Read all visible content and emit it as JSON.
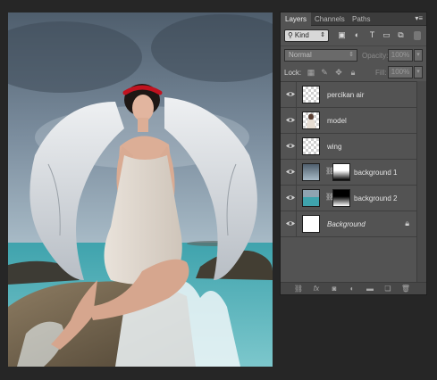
{
  "panel": {
    "tabs": [
      {
        "label": "Layers",
        "active": true
      },
      {
        "label": "Channels",
        "active": false
      },
      {
        "label": "Paths",
        "active": false
      }
    ],
    "menu_icon": "panel-menu-icon"
  },
  "filter": {
    "kind_label": "Kind",
    "icons": [
      "pixel-filter-icon",
      "adjustment-filter-icon",
      "type-filter-icon",
      "shape-filter-icon",
      "smart-object-filter-icon"
    ]
  },
  "blend": {
    "mode": "Normal",
    "opacity_label": "Opacity:",
    "opacity_value": "100%"
  },
  "lock": {
    "label": "Lock:",
    "fill_label": "Fill:",
    "fill_value": "100%",
    "icons": [
      "lock-transparent-icon",
      "lock-image-icon",
      "lock-position-icon",
      "lock-all-icon"
    ]
  },
  "layers": [
    {
      "name": "percikan air",
      "thumb": "checker",
      "italic": false,
      "masked": false,
      "locked": false,
      "visible": true
    },
    {
      "name": "model",
      "thumb": "model",
      "italic": false,
      "masked": false,
      "locked": false,
      "visible": true
    },
    {
      "name": "wing",
      "thumb": "checker",
      "italic": false,
      "masked": false,
      "locked": false,
      "visible": true
    },
    {
      "name": "background 1",
      "thumb": "sky",
      "italic": false,
      "masked": true,
      "locked": false,
      "visible": true
    },
    {
      "name": "background 2",
      "thumb": "sea",
      "italic": false,
      "masked": true,
      "locked": false,
      "visible": true
    },
    {
      "name": "Background",
      "thumb": "white",
      "italic": true,
      "masked": false,
      "locked": true,
      "visible": true
    }
  ],
  "footer_icons": [
    "link-layers-icon",
    "fx-icon",
    "add-mask-icon",
    "adjustment-layer-icon",
    "new-group-icon",
    "new-layer-icon",
    "delete-layer-icon"
  ],
  "colors": {
    "app_bg": "#262626",
    "panel_bg": "#535353",
    "sky": "#7f93a4",
    "sea": "#3fa3ad"
  }
}
